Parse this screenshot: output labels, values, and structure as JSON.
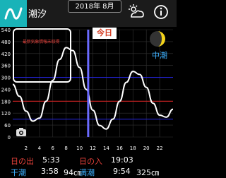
{
  "header": {
    "title": "潮汐",
    "date": "2018年 8月"
  },
  "today_label": "今日",
  "moon_phase": "中潮",
  "weather_notice": "最新気象情報未取得",
  "chart_data": {
    "type": "line",
    "title": "",
    "xlabel": "",
    "ylabel": "",
    "y_ticks": [
      "540",
      "480",
      "420",
      "360",
      "300",
      "240",
      "180",
      "120",
      "60",
      "0"
    ],
    "x_ticks": [
      "2",
      "4",
      "6",
      "8",
      "10",
      "12",
      "14",
      "16",
      "18",
      "20",
      "22"
    ],
    "ylim": [
      0,
      540
    ],
    "xlim": [
      0,
      24
    ],
    "current_time_x": 11.3,
    "reference_lines": [
      {
        "name": "blue-upper",
        "y": 300,
        "color": "#2222cc"
      },
      {
        "name": "red",
        "y": 180,
        "color": "#cc2222"
      },
      {
        "name": "blue-lower",
        "y": 90,
        "color": "#2222cc"
      }
    ],
    "series": [
      {
        "x": [
          0,
          1,
          2,
          3,
          4,
          5,
          6,
          7,
          8,
          9,
          10,
          11,
          12,
          13,
          14,
          15,
          16,
          17,
          18,
          19,
          20,
          21,
          22,
          23,
          24
        ],
        "values": [
          265,
          205,
          130,
          80,
          95,
          180,
          285,
          390,
          450,
          435,
          350,
          240,
          135,
          58,
          40,
          90,
          180,
          275,
          330,
          315,
          250,
          170,
          110,
          100,
          140
        ]
      }
    ]
  },
  "sun": {
    "rise_label": "日の出",
    "rise_time": "5:33",
    "set_label": "日の入",
    "set_time": "19:03"
  },
  "tide": {
    "low_label": "干潮",
    "low_time": "3:58",
    "low_height": "94㎝",
    "high_label": "満潮",
    "high_time": "9:54",
    "high_height": "325㎝"
  },
  "colors": {
    "accent_blue": "#3db1ff",
    "accent_red": "#e4413a",
    "now_line": "#6b6bff"
  }
}
